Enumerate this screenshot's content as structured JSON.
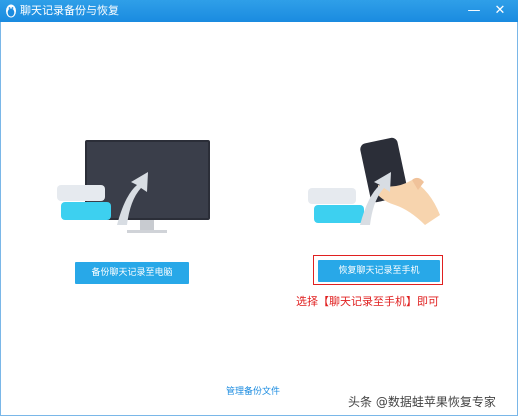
{
  "window": {
    "title": "聊天记录备份与恢复",
    "minimize_glyph": "—",
    "close_glyph": "✕",
    "title_icon": "penguin-icon"
  },
  "backup": {
    "button_label": "备份聊天记录至电脑",
    "illustration": "monitor-illustration"
  },
  "restore": {
    "button_label": "恢复聊天记录至手机",
    "illustration": "phone-in-hand-illustration"
  },
  "annotation": {
    "text": "选择【聊天记录至手机】即可",
    "color": "#e02020"
  },
  "footer": {
    "manage_label": "管理备份文件"
  },
  "watermark": {
    "text": "头条 @数据蛙苹果恢复专家"
  },
  "colors": {
    "titlebar": "#1a8be0",
    "button": "#28a8e8",
    "link": "#1a8be0"
  }
}
